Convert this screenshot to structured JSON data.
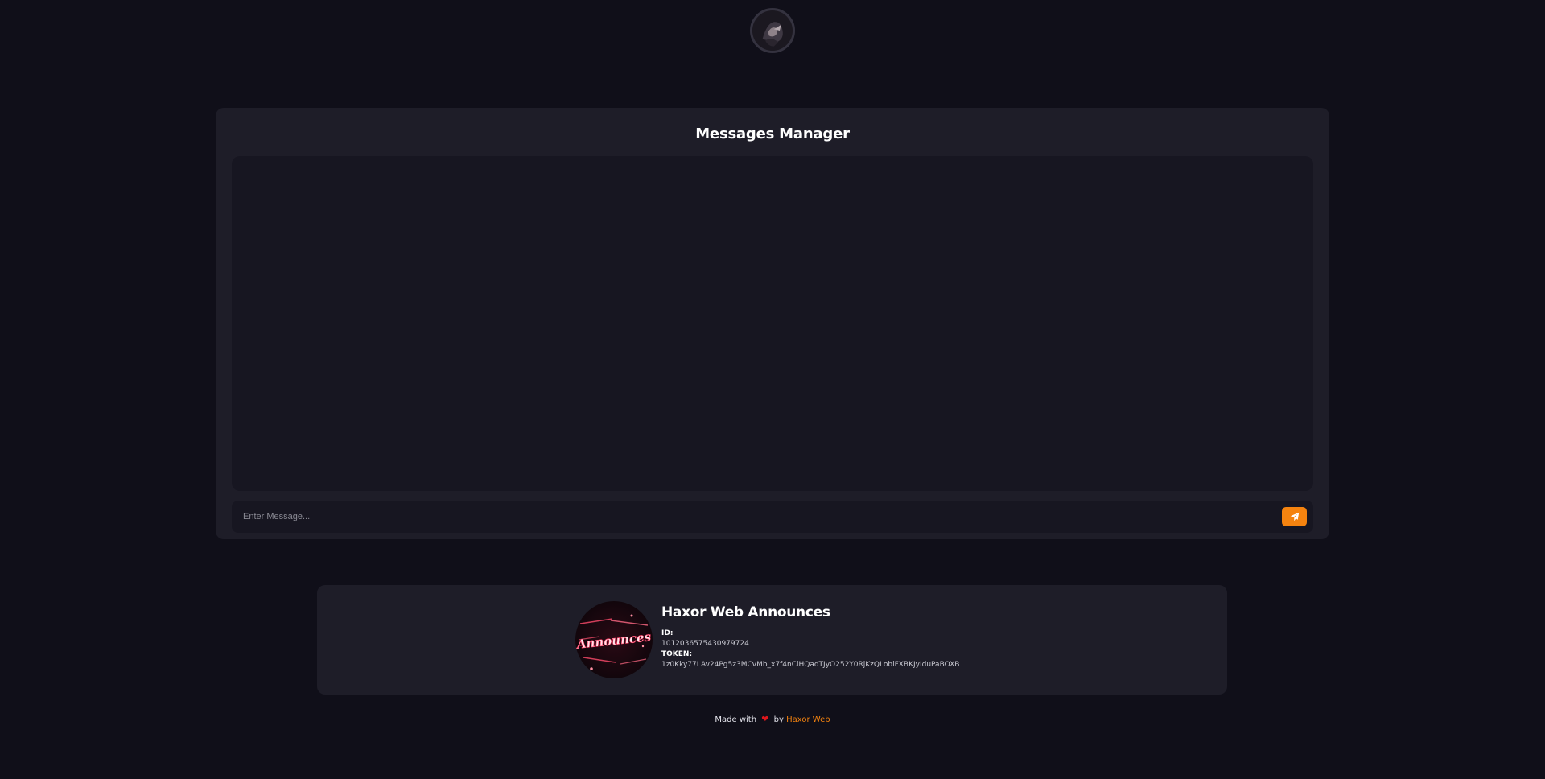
{
  "header": {
    "avatar_icon": "user-avatar-icon"
  },
  "manager": {
    "title": "Messages Manager",
    "input": {
      "placeholder": "Enter Message...",
      "value": ""
    },
    "send_icon": "paper-plane-icon",
    "accent_color": "#f5830f"
  },
  "bot": {
    "name": "Haxor Web Announces",
    "avatar_text": "Announces",
    "id_label": "ID:",
    "id_value": "1012036575430979724",
    "token_label": "TOKEN:",
    "token_value": "1z0Kky77LAv24Pg5z3MCvMb_x7f4nClHQadTJyO252Y0RjKzQLobiFXBKJyIduPaBOXB"
  },
  "footer": {
    "made_with": "Made with",
    "heart": "❤",
    "by": "by",
    "link_text": "Haxor Web"
  }
}
